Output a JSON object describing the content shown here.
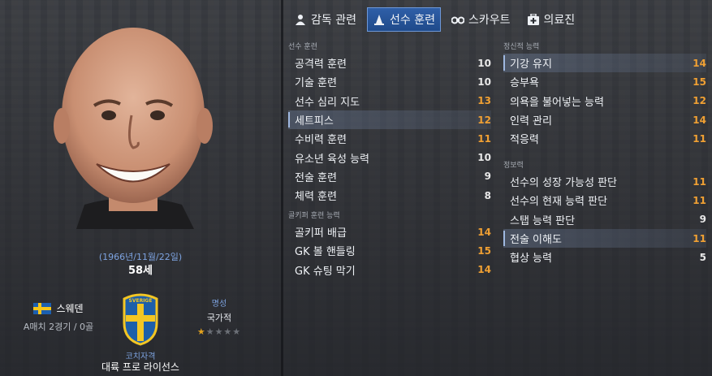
{
  "tabs": [
    {
      "label": "감독 관련",
      "icon": "manager-icon",
      "active": false
    },
    {
      "label": "선수 훈련",
      "icon": "training-cone-icon",
      "active": true
    },
    {
      "label": "스카우트",
      "icon": "binoculars-icon",
      "active": false
    },
    {
      "label": "의료진",
      "icon": "medical-kit-icon",
      "active": false
    }
  ],
  "profile": {
    "dob": "(1966년/11월/22일)",
    "age": "58세",
    "nation": "스웨덴",
    "caps": "A매치 2경기 / 0골",
    "license_title": "코치자격",
    "license_value": "대륙 프로 라이선스",
    "reputation_title": "명성",
    "reputation_value": "국가적",
    "reputation_stars": 0.5,
    "badge_text": "SVERIGE"
  },
  "sections": {
    "coaching": "선수 훈련",
    "goalkeeping": "골키퍼 훈련 능력",
    "mental": "정신적 능력",
    "knowledge": "정보력"
  },
  "coaching": [
    {
      "name": "공격력 훈련",
      "value": "10",
      "color": "white",
      "hl": false
    },
    {
      "name": "기술 훈련",
      "value": "10",
      "color": "white",
      "hl": false
    },
    {
      "name": "선수 심리 지도",
      "value": "13",
      "color": "orange",
      "hl": false
    },
    {
      "name": "세트피스",
      "value": "12",
      "color": "orange",
      "hl": true
    },
    {
      "name": "수비력 훈련",
      "value": "11",
      "color": "orange",
      "hl": false
    },
    {
      "name": "유소년 육성 능력",
      "value": "10",
      "color": "white",
      "hl": false
    },
    {
      "name": "전술 훈련",
      "value": "9",
      "color": "white",
      "hl": false
    },
    {
      "name": "체력 훈련",
      "value": "8",
      "color": "white",
      "hl": false
    }
  ],
  "goalkeeping": [
    {
      "name": "골키퍼 배급",
      "value": "14",
      "color": "orange",
      "hl": false
    },
    {
      "name": "GK 볼 핸들링",
      "value": "15",
      "color": "orange",
      "hl": false
    },
    {
      "name": "GK 슈팅 막기",
      "value": "14",
      "color": "orange",
      "hl": false
    }
  ],
  "mental": [
    {
      "name": "기강 유지",
      "value": "14",
      "color": "orange",
      "hl": true
    },
    {
      "name": "승부욕",
      "value": "15",
      "color": "orange",
      "hl": false
    },
    {
      "name": "의욕을 불어넣는 능력",
      "value": "12",
      "color": "orange",
      "hl": false
    },
    {
      "name": "인력 관리",
      "value": "14",
      "color": "orange",
      "hl": false
    },
    {
      "name": "적응력",
      "value": "11",
      "color": "orange",
      "hl": false
    }
  ],
  "knowledge": [
    {
      "name": "선수의 성장 가능성 판단",
      "value": "11",
      "color": "orange",
      "hl": false
    },
    {
      "name": "선수의 현재 능력 판단",
      "value": "11",
      "color": "orange",
      "hl": false
    },
    {
      "name": "스탭 능력 판단",
      "value": "9",
      "color": "white",
      "hl": false
    },
    {
      "name": "전술 이해도",
      "value": "11",
      "color": "orange",
      "hl": true
    },
    {
      "name": "협상 능력",
      "value": "5",
      "color": "white",
      "hl": false
    }
  ]
}
